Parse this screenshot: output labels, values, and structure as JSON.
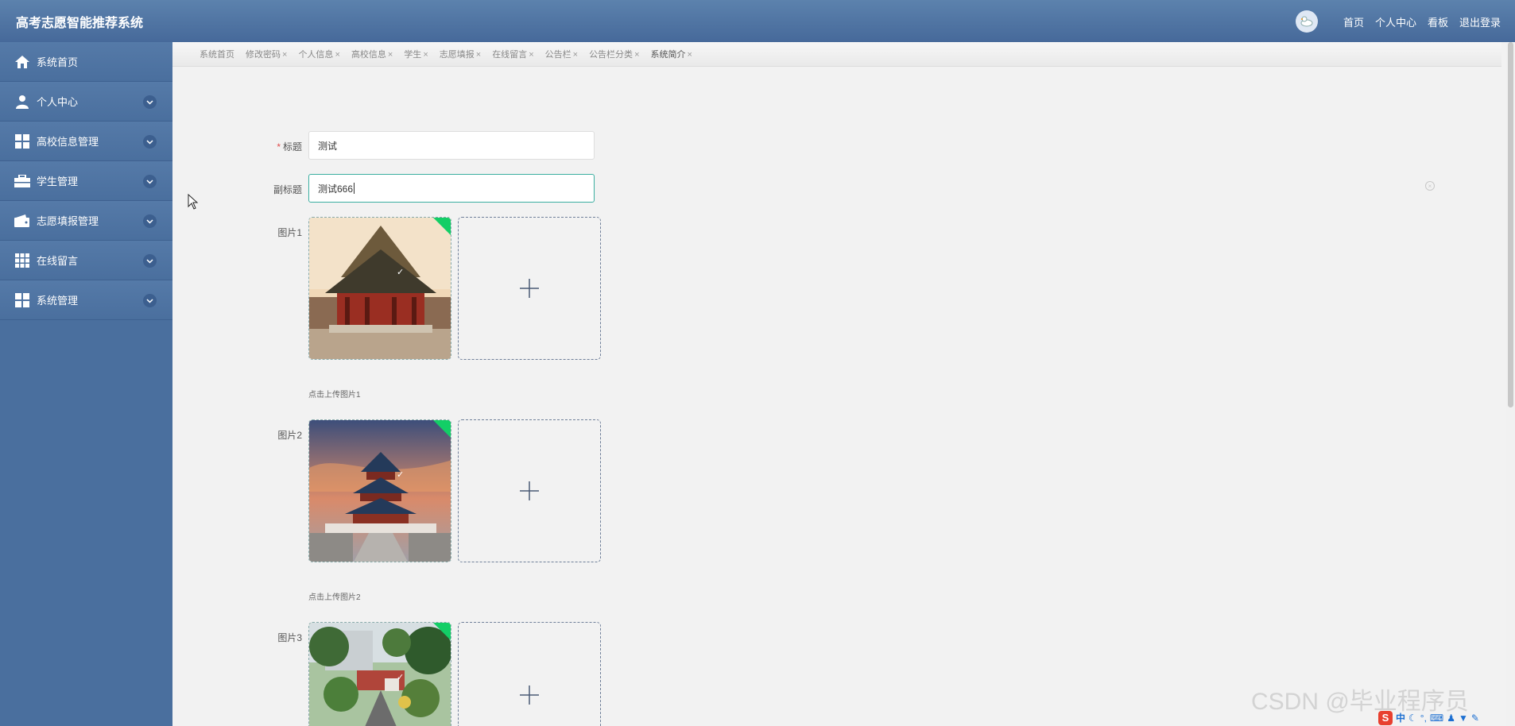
{
  "header": {
    "title": "高考志愿智能推荐系统",
    "nav": [
      "首页",
      "个人中心",
      "看板",
      "退出登录"
    ]
  },
  "sidebar": {
    "items": [
      {
        "label": "系统首页",
        "icon": "home-icon"
      },
      {
        "label": "个人中心",
        "icon": "user-icon"
      },
      {
        "label": "高校信息管理",
        "icon": "grid-icon"
      },
      {
        "label": "学生管理",
        "icon": "briefcase-icon"
      },
      {
        "label": "志愿填报管理",
        "icon": "wallet-icon"
      },
      {
        "label": "在线留言",
        "icon": "grid9-icon"
      },
      {
        "label": "系统管理",
        "icon": "grid-icon"
      }
    ]
  },
  "tabs": [
    "系统首页",
    "修改密码",
    "个人信息",
    "高校信息",
    "学生",
    "志愿填报",
    "在线留言",
    "公告栏",
    "公告栏分类",
    "系统简介"
  ],
  "form": {
    "title_label": "标题",
    "title_value": "测试",
    "subtitle_label": "副标题",
    "subtitle_value": "测试666",
    "pic1_label": "图片1",
    "pic1_tip": "点击上传图片1",
    "pic2_label": "图片2",
    "pic2_tip": "点击上传图片2",
    "pic3_label": "图片3"
  },
  "watermark": "CSDN @毕业程序员",
  "tray": {
    "ime": "中"
  },
  "colors": {
    "header": "#5c82ad",
    "sidebar": "#4a6f9e",
    "accent": "#13ce66",
    "focus": "#3aaea0",
    "required": "#e04b4b"
  }
}
